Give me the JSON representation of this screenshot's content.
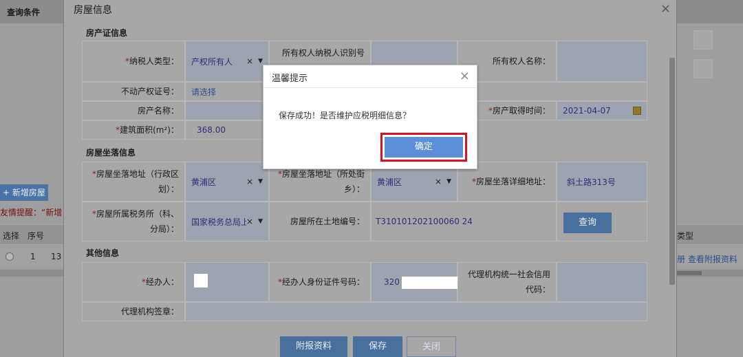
{
  "background": {
    "title": "查询条件",
    "add_button": "+ 新增房屋",
    "tip": "友情提醒：“新增",
    "table_headers": [
      "选择",
      "序号"
    ],
    "table_header_right": "类型",
    "row": {
      "index": "1",
      "id_part": "13",
      "link": "册 查看附报资料"
    }
  },
  "modal": {
    "title": "房屋信息",
    "close_icon": "×",
    "sections": {
      "cert": "房产证信息",
      "location": "房屋坐落信息",
      "other": "其他信息"
    },
    "fields": {
      "taxpayer_type_label": "纳税人类型：",
      "taxpayer_type_value": "产权所有人",
      "owner_tax_id_label": "所有权人纳税人识别号",
      "owner_name_label": "所有权人名称：",
      "property_cert_label": "不动产权证号：",
      "property_cert_value": "请选择",
      "house_name_label": "房产名称：",
      "acquire_time_label": "房产取得时间：",
      "acquire_time_value": "2021-04-07",
      "area_label": "建筑面积(m²)：",
      "area_value": "368.00",
      "district_label_1": "房屋坐落地址（行政区",
      "district_label_2": "划）：",
      "district_value": "黄浦区",
      "street_label_1": "房屋坐落地址（所处街",
      "street_label_2": "乡）：",
      "street_value": "黄浦区",
      "detail_addr_label": "房屋坐落详细地址：",
      "detail_addr_value": "斜土路313号",
      "tax_office_label_1": "房屋所属税务所（科、",
      "tax_office_label_2": "分局）：",
      "tax_office_value": "国家税务总局上",
      "land_no_label": "房屋所在土地编号：",
      "land_no_value": "T310101202100060 24",
      "query_button": "查询",
      "handler_label": "经办人：",
      "handler_id_label": "经办人身份证件号码：",
      "handler_id_value": "320",
      "agency_credit_label_1": "代理机构统一社会信用",
      "agency_credit_label_2": "代码：",
      "agency_seal_label": "代理机构签章："
    },
    "footer": {
      "attach_button": "附报资料",
      "save_button": "保存",
      "close_button": "关闭"
    }
  },
  "alert": {
    "title": "温馨提示",
    "close_icon": "×",
    "message": "保存成功！是否维护应税明细信息？",
    "confirm_button": "确定"
  },
  "colors": {
    "highlight_border": "#d8121e",
    "primary_button": "#5b8fd9"
  }
}
